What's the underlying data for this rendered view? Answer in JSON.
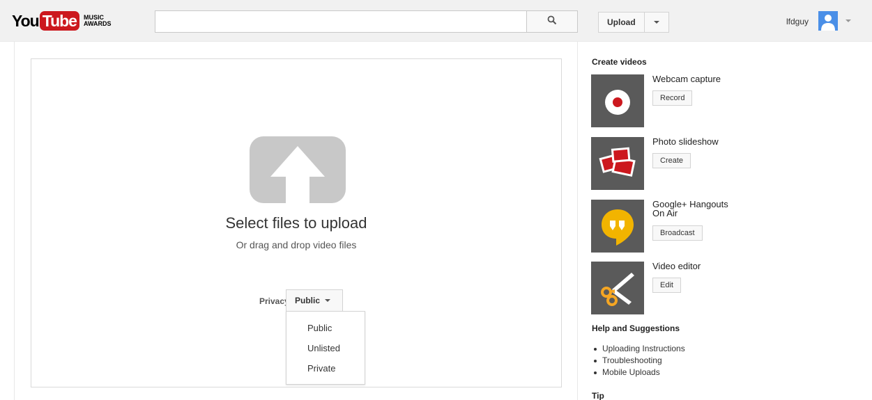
{
  "header": {
    "logo_you": "You",
    "logo_tube": "Tube",
    "logo_sub": "MUSIC AWARDS",
    "search_placeholder": "",
    "upload_label": "Upload",
    "username": "lfdguy"
  },
  "upload": {
    "title": "Select files to upload",
    "subtitle": "Or drag and drop video files",
    "privacy_label": "Privacy:",
    "privacy_value": "Public",
    "privacy_options": [
      "Public",
      "Unlisted",
      "Private"
    ]
  },
  "sidebar": {
    "create_heading": "Create videos",
    "features": [
      {
        "title": "Webcam capture",
        "button": "Record",
        "icon": "record-icon"
      },
      {
        "title": "Photo slideshow",
        "button": "Create",
        "icon": "photos-icon"
      },
      {
        "title_line1": "Google+ Hangouts",
        "title_line2": "On Air",
        "button": "Broadcast",
        "icon": "hangouts-icon"
      },
      {
        "title": "Video editor",
        "button": "Edit",
        "icon": "scissors-icon"
      }
    ],
    "help_heading": "Help and Suggestions",
    "help_links": [
      "Uploading Instructions",
      "Troubleshooting",
      "Mobile Uploads"
    ],
    "tip_heading": "Tip"
  },
  "colors": {
    "brand_red": "#cc181e",
    "header_bg": "#f1f1f1",
    "hangouts_yellow": "#f2b400",
    "editor_orange": "#f5a623"
  }
}
